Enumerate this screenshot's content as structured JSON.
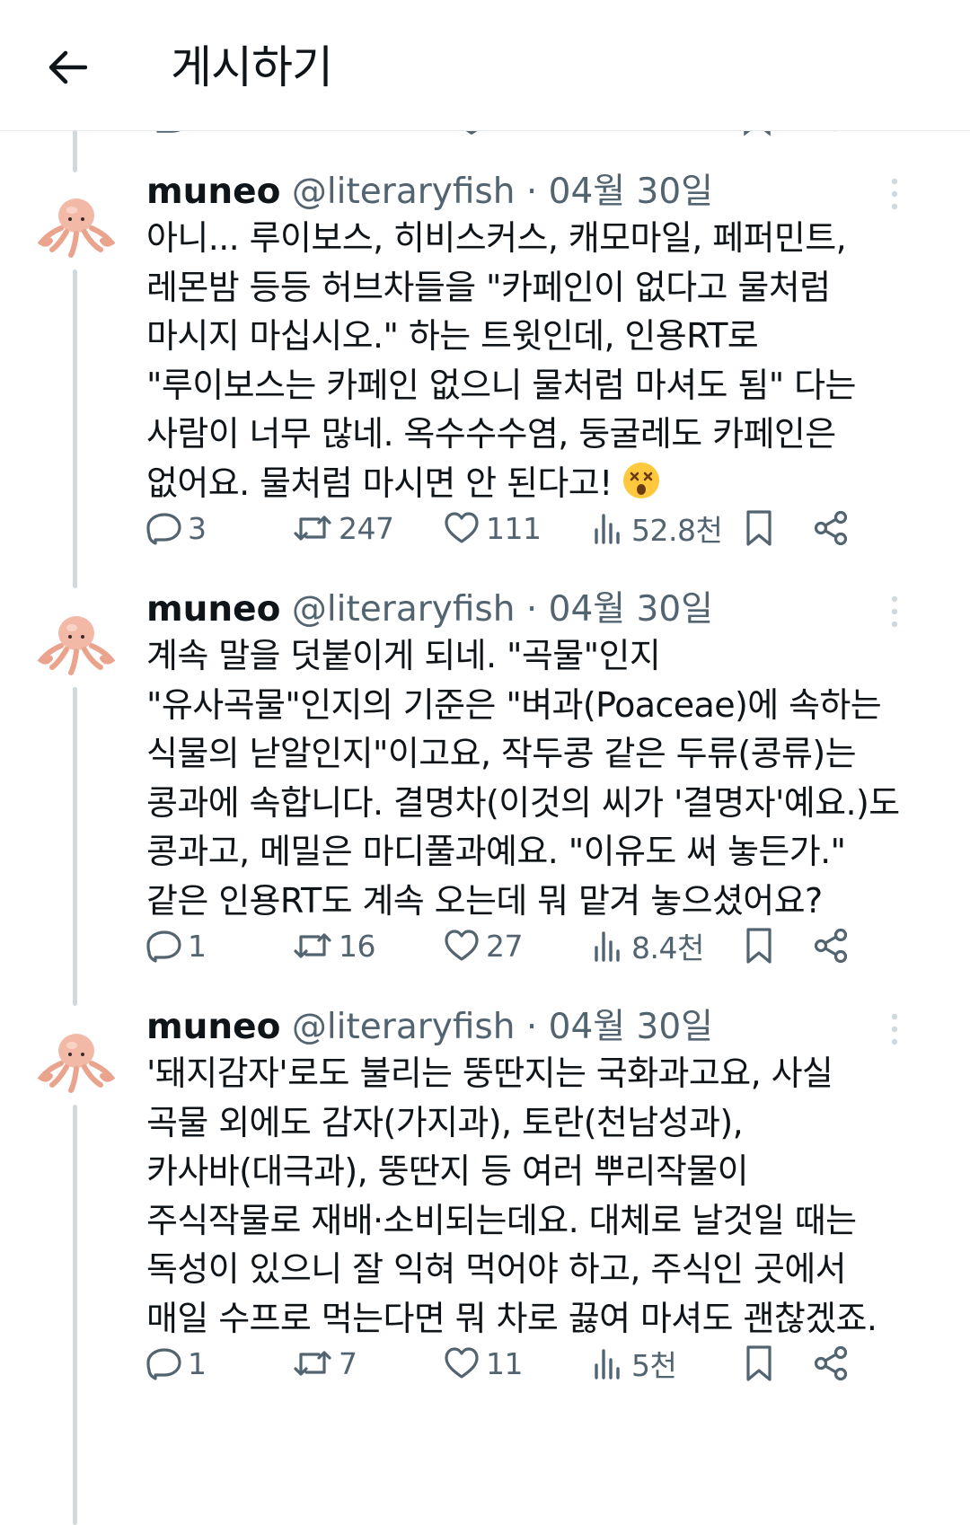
{
  "header": {
    "title": "게시하기"
  },
  "author": {
    "name": "muneo",
    "handle": "@literaryfish",
    "separator": "·"
  },
  "tweets": [
    {
      "date": "04월 30일",
      "lines": [
        "아니... 루이보스, 히비스커스, 캐모마일, 페퍼민트,",
        "레몬밤 등등 허브차들을 \"카페인이 없다고 물처럼",
        "마시지 마십시오.\" 하는 트윗인데, 인용RT로",
        "\"루이보스는 카페인 없으니 물처럼 마셔도 됨\" 다는",
        "사람이 너무 많네. 옥수수수염, 둥굴레도 카페인은",
        "없어요. 물처럼 마시면 안 된다고!"
      ],
      "emoji": "dizzy-face-emoji",
      "replies": "3",
      "retweets": "247",
      "likes": "111",
      "views": "52.8천"
    },
    {
      "date": "04월 30일",
      "lines": [
        "계속 말을 덧붙이게 되네. \"곡물\"인지",
        "\"유사곡물\"인지의 기준은 \"벼과(Poaceae)에 속하는",
        "식물의 낟알인지\"이고요, 작두콩 같은 두류(콩류)는",
        "콩과에 속합니다. 결명차(이것의 씨가 '결명자'예요.)도",
        "콩과고, 메밀은 마디풀과예요. \"이유도 써 놓든가.\"",
        "같은 인용RT도 계속 오는데 뭐 맡겨 놓으셨어요?"
      ],
      "replies": "1",
      "retweets": "16",
      "likes": "27",
      "views": "8.4천"
    },
    {
      "date": "04월 30일",
      "lines": [
        "'돼지감자'로도 불리는 뚱딴지는 국화과고요, 사실",
        "곡물 외에도 감자(가지과), 토란(천남성과),",
        "카사바(대극과), 뚱딴지 등 여러 뿌리작물이",
        "주식작물로 재배·소비되는데요. 대체로 날것일 때는",
        "독성이 있으니 잘 익혀 먹어야 하고, 주식인 곳에서",
        "매일 수프로 먹는다면 뭐 차로 끓여 마셔도 괜찮겠죠."
      ],
      "replies": "1",
      "retweets": "7",
      "likes": "11",
      "views": "5천"
    }
  ],
  "colors": {
    "text": "#0f1419",
    "secondary": "#536471",
    "thread_line": "#cfd9de",
    "divider": "#e6e9ec",
    "avatar_octopus": "#f2b9a6"
  }
}
